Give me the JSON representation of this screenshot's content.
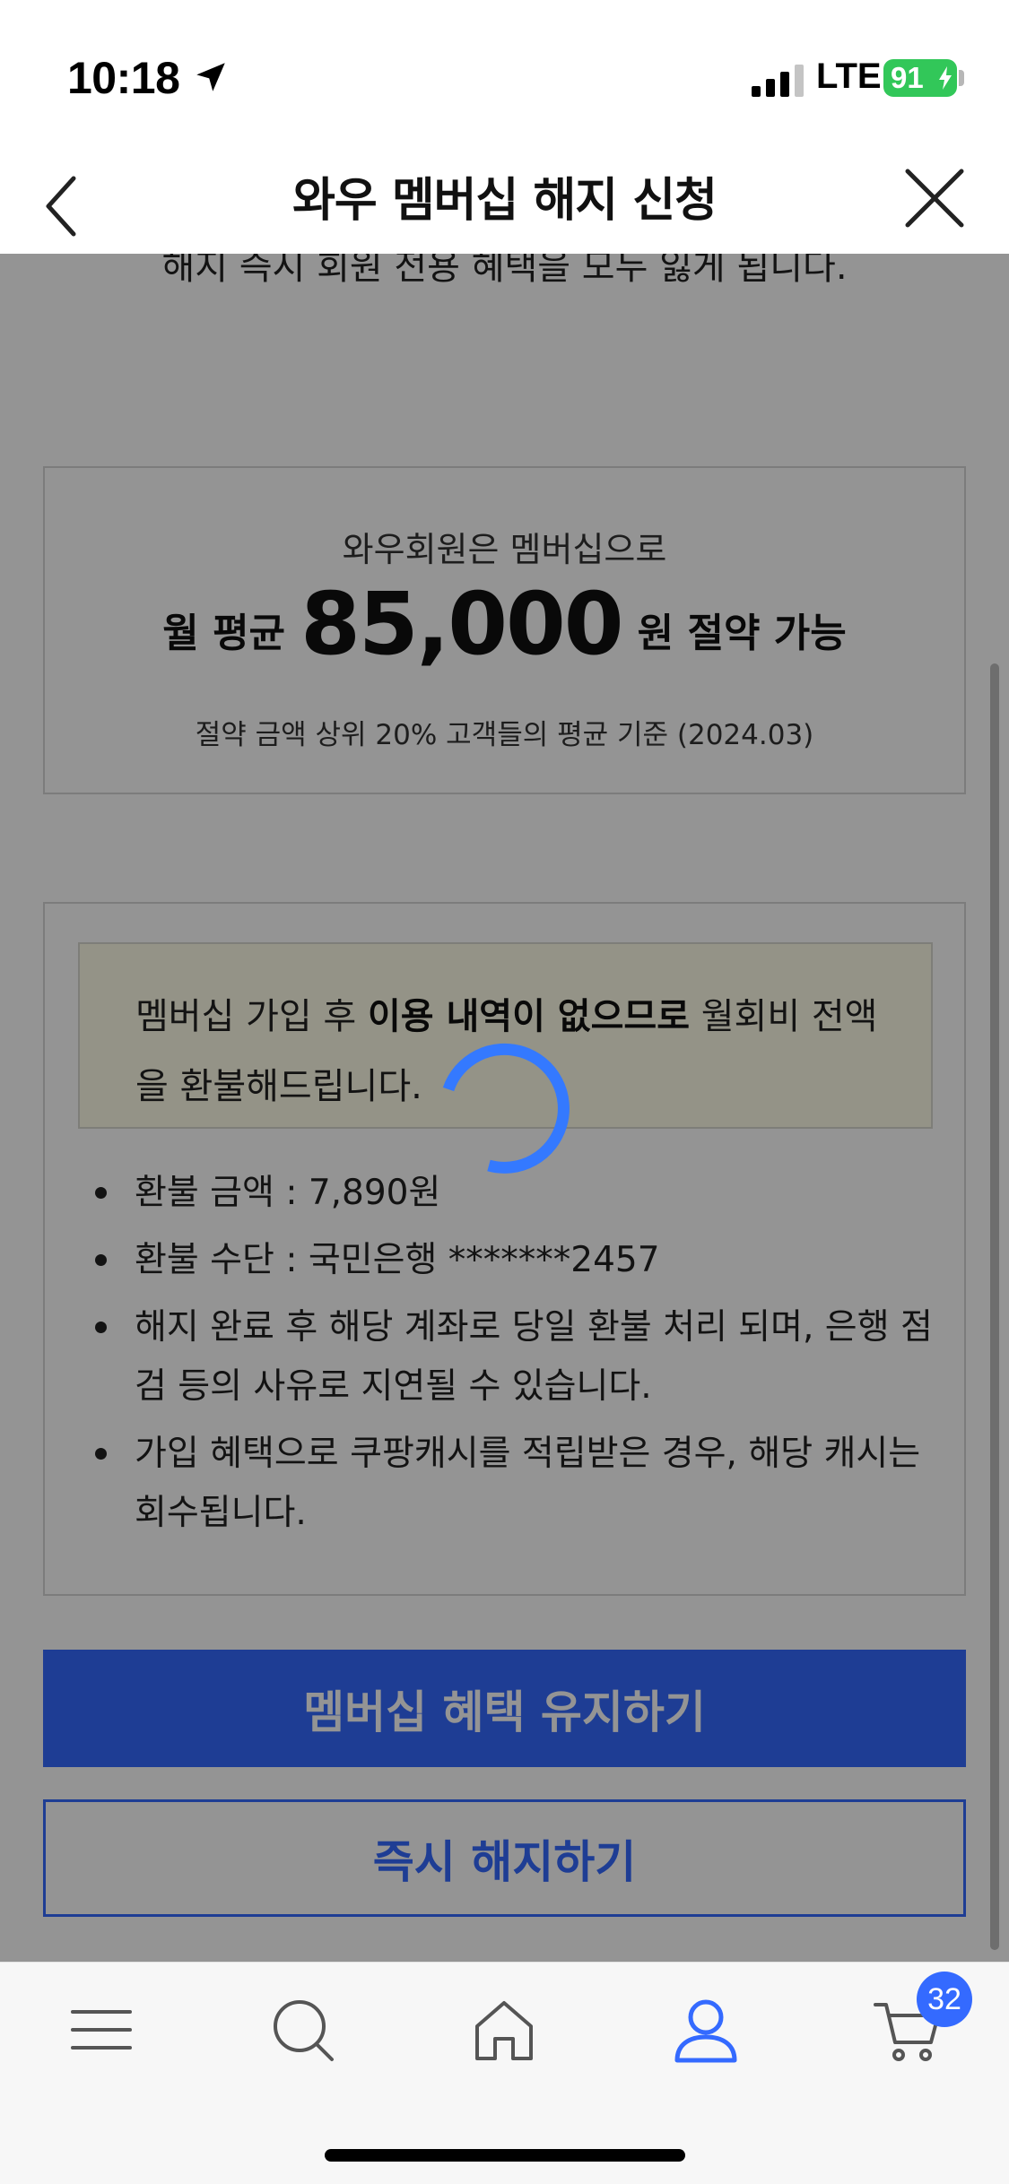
{
  "status_bar": {
    "time": "10:18",
    "network": "LTE",
    "battery": "91",
    "icons": [
      "location-arrow-icon",
      "signal-icon",
      "battery-icon"
    ]
  },
  "header": {
    "title": "와우 멤버십 해지 신청",
    "back_icon": "chevron-left-icon",
    "close_icon": "close-icon"
  },
  "notice": "해지 즉시 회원 전용 혜택을 모두 잃게 됩니다.",
  "saving": {
    "subtitle": "와우회원은 멤버십으로",
    "prefix": "월 평균",
    "amount": "85,000",
    "suffix": "원 절약 가능",
    "note": "절약 금액 상위 20% 고객들의 평균 기준 (2024.03)"
  },
  "refund": {
    "highlight_pre": "멤버십 가입 후 ",
    "highlight_bold": "이용 내역이 없으므로",
    "highlight_post": " 월회비 전액을 환불해드립니다.",
    "items": [
      {
        "text": "환불 금액 : 7,890원"
      },
      {
        "text": "환불 수단 : 국민은행 *******2457"
      },
      {
        "text": "해지 완료 후 해당 계좌로 당일 환불 처리 되며, 은행 점검 등의 사유로 지연될 수 있습니다."
      },
      {
        "text": "가입 혜택으로 쿠팡캐시를 적립받은 경우, 해당 캐시는 회수됩니다."
      }
    ]
  },
  "buttons": {
    "keep_label": "멤버십 혜택 유지하기",
    "cancel_label": "즉시 해지하기"
  },
  "loading": {
    "icon": "loading-spinner-icon"
  },
  "tab_bar": {
    "tabs": [
      {
        "name": "menu",
        "icon": "hamburger-menu-icon"
      },
      {
        "name": "search",
        "icon": "search-icon"
      },
      {
        "name": "home",
        "icon": "home-icon"
      },
      {
        "name": "my",
        "icon": "user-icon",
        "active": true
      },
      {
        "name": "cart",
        "icon": "cart-icon"
      }
    ],
    "cart_count": "32"
  },
  "colors": {
    "accent": "#346aff",
    "battery": "#32c759",
    "highlight_bg": "#fffde9",
    "dim_overlay": "rgba(0,0,0,0.42)"
  }
}
